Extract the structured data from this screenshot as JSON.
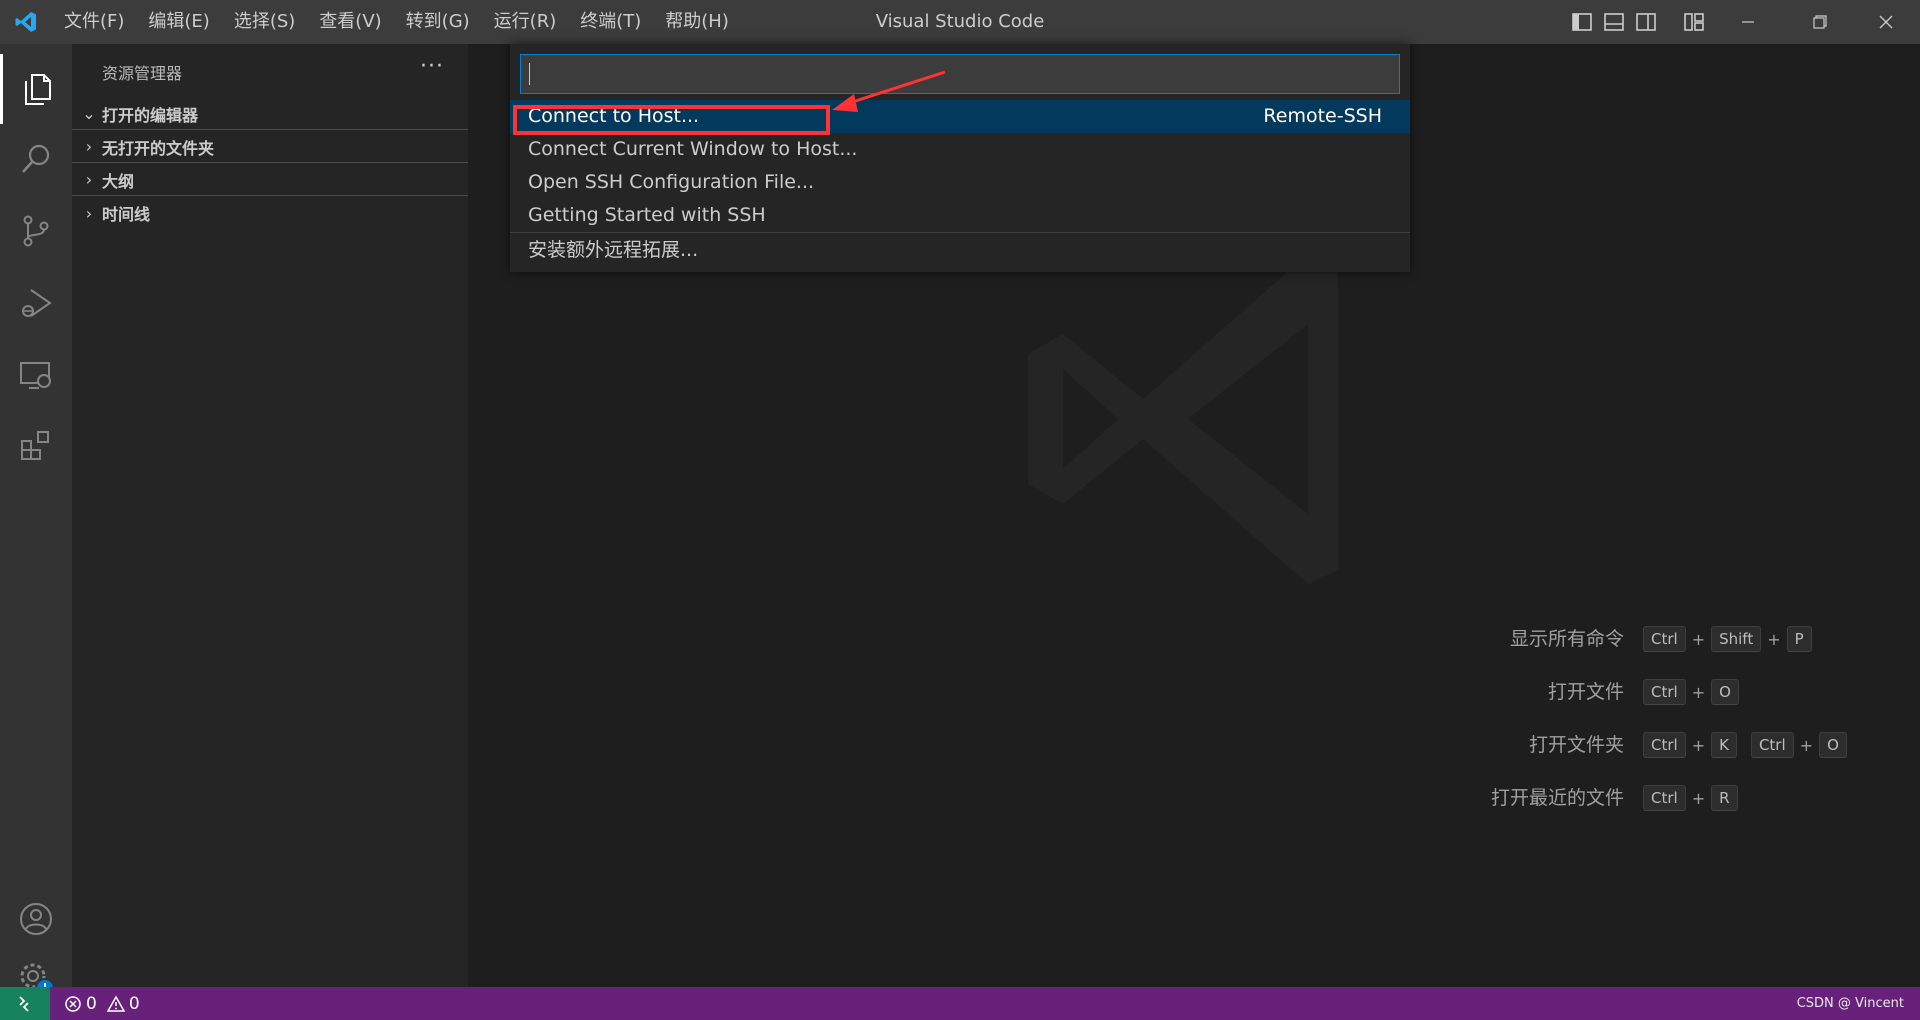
{
  "window": {
    "title": "Visual Studio Code"
  },
  "menu": [
    "文件(F)",
    "编辑(E)",
    "选择(S)",
    "查看(V)",
    "转到(G)",
    "运行(R)",
    "终端(T)",
    "帮助(H)"
  ],
  "activity_bar": {
    "items": [
      "explorer-icon",
      "search-icon",
      "source-control-icon",
      "run-debug-icon",
      "remote-explorer-icon",
      "extensions-icon"
    ],
    "bottom": [
      "accounts-icon",
      "manage-gear-icon"
    ]
  },
  "sidebar": {
    "title": "资源管理器",
    "more": "···",
    "sections": [
      {
        "label": "打开的编辑器",
        "expanded": true
      },
      {
        "label": "无打开的文件夹",
        "expanded": false
      },
      {
        "label": "大纲",
        "expanded": false
      },
      {
        "label": "时间线",
        "expanded": false
      }
    ]
  },
  "quick_pick": {
    "input_value": "",
    "items": [
      {
        "label": "Connect to Host...",
        "detail": "Remote-SSH",
        "selected": true
      },
      {
        "label": "Connect Current Window to Host..."
      },
      {
        "label": "Open SSH Configuration File..."
      },
      {
        "label": "Getting Started with SSH"
      },
      {
        "label": "安装额外远程拓展..."
      }
    ]
  },
  "shortcuts": [
    {
      "label": "显示所有命令",
      "keys": [
        [
          "Ctrl",
          "Shift",
          "P"
        ]
      ]
    },
    {
      "label": "打开文件",
      "keys": [
        [
          "Ctrl",
          "O"
        ]
      ]
    },
    {
      "label": "打开文件夹",
      "keys": [
        [
          "Ctrl",
          "K"
        ],
        [
          "Ctrl",
          "O"
        ]
      ]
    },
    {
      "label": "打开最近的文件",
      "keys": [
        [
          "Ctrl",
          "R"
        ]
      ]
    }
  ],
  "status_bar": {
    "errors": "0",
    "warnings": "0",
    "watermark": "CSDN @ Vincent"
  },
  "colors": {
    "titlebar": "#3c3c3c",
    "activitybar": "#333333",
    "sidebar": "#252526",
    "editor": "#1e1e1e",
    "statusbar": "#68217a",
    "remote_indicator": "#16825d",
    "selection": "#04395e",
    "annotation": "#ff3333"
  }
}
